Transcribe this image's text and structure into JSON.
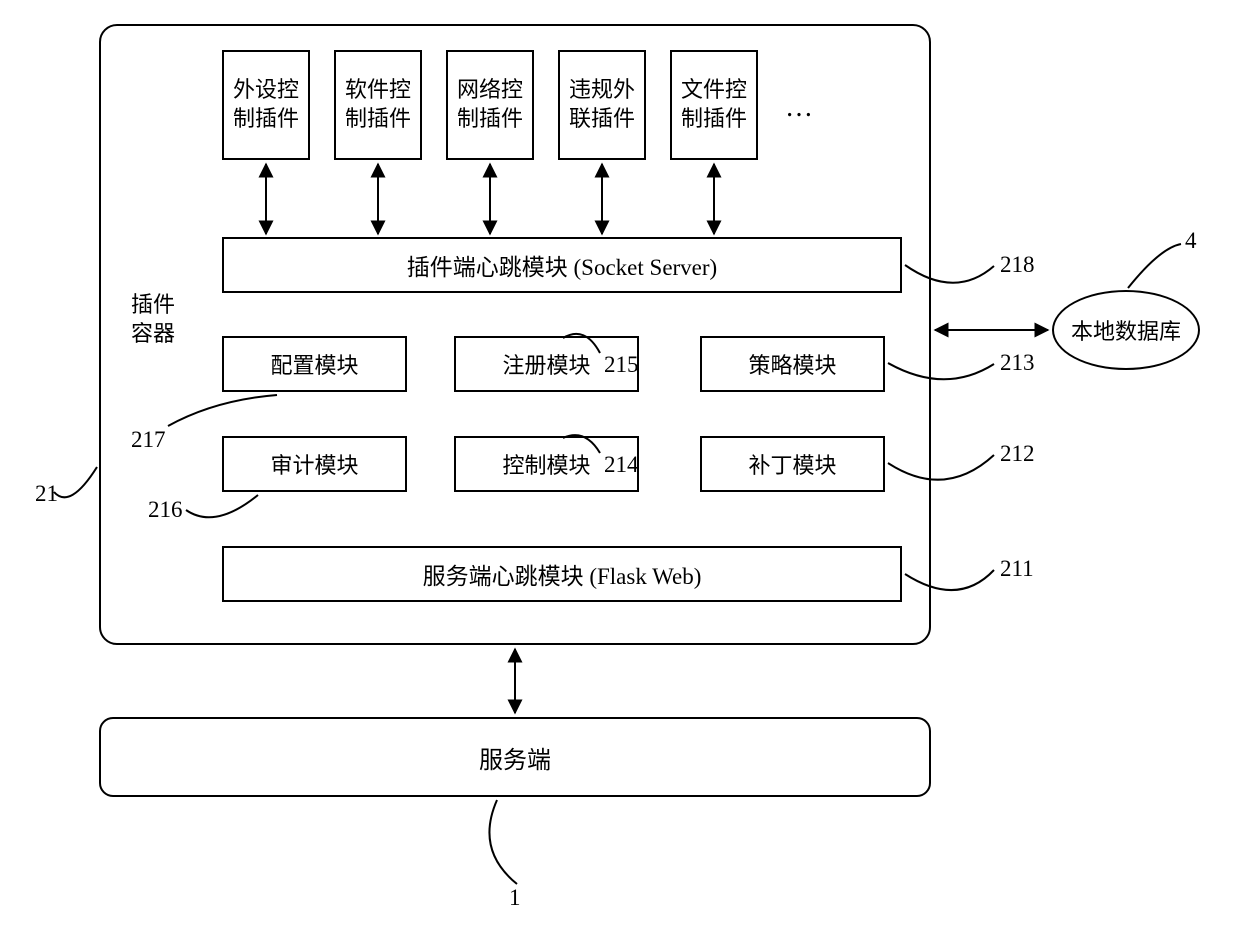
{
  "plugins": {
    "p1": "外设控\n制插件",
    "p2": "软件控\n制插件",
    "p3": "网络控\n制插件",
    "p4": "违规外\n联插件",
    "p5": "文件控\n制插件",
    "more": "…"
  },
  "socket_server": "插件端心跳模块 (Socket Server)",
  "modules": {
    "config": "配置模块",
    "register": "注册模块",
    "strategy": "策略模块",
    "audit": "审计模块",
    "control": "控制模块",
    "patch": "补丁模块"
  },
  "flask_web": "服务端心跳模块 (Flask Web)",
  "server": "服务端",
  "container_label": "插件\n容器",
  "local_db": "本地数据库",
  "refs": {
    "r1": "1",
    "r4": "4",
    "r21": "21",
    "r211": "211",
    "r212": "212",
    "r213": "213",
    "r214": "214",
    "r215": "215",
    "r216": "216",
    "r217": "217",
    "r218": "218"
  }
}
